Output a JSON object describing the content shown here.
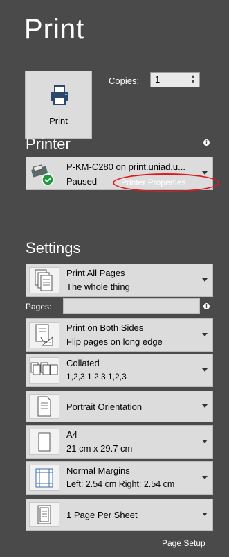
{
  "header": {
    "title": "Print"
  },
  "print_button": {
    "label": "Print"
  },
  "copies": {
    "label": "Copies:",
    "value": "1"
  },
  "printer": {
    "section_title": "Printer",
    "name": "P-KM-C280 on print.uniad.u...",
    "status": "Paused",
    "properties_link": "Printer Properties"
  },
  "settings": {
    "section_title": "Settings",
    "pages_label": "Pages:",
    "pages_value": "",
    "items": [
      {
        "line1": "Print All Pages",
        "line2": "The whole thing",
        "icon": "pages-icon"
      },
      {
        "line1": "Print on Both Sides",
        "line2": "Flip pages on long edge",
        "icon": "duplex-icon"
      },
      {
        "line1": "Collated",
        "line2": "1,2,3    1,2,3    1,2,3",
        "icon": "collated-icon"
      },
      {
        "line1": "Portrait Orientation",
        "line2": "",
        "icon": "portrait-icon"
      },
      {
        "line1": "A4",
        "line2": "21 cm x 29.7 cm",
        "icon": "paper-size-icon"
      },
      {
        "line1": "Normal Margins",
        "line2": "Left:  2.54 cm    Right:  2.54 cm",
        "icon": "margins-icon"
      },
      {
        "line1": "1 Page Per Sheet",
        "line2": "",
        "icon": "pages-per-sheet-icon"
      }
    ]
  },
  "footer": {
    "page_setup_link": "Page Setup"
  },
  "colors": {
    "background": "#4a4a4a",
    "control": "#dcdcdc",
    "highlight_oval": "#e0181e"
  }
}
